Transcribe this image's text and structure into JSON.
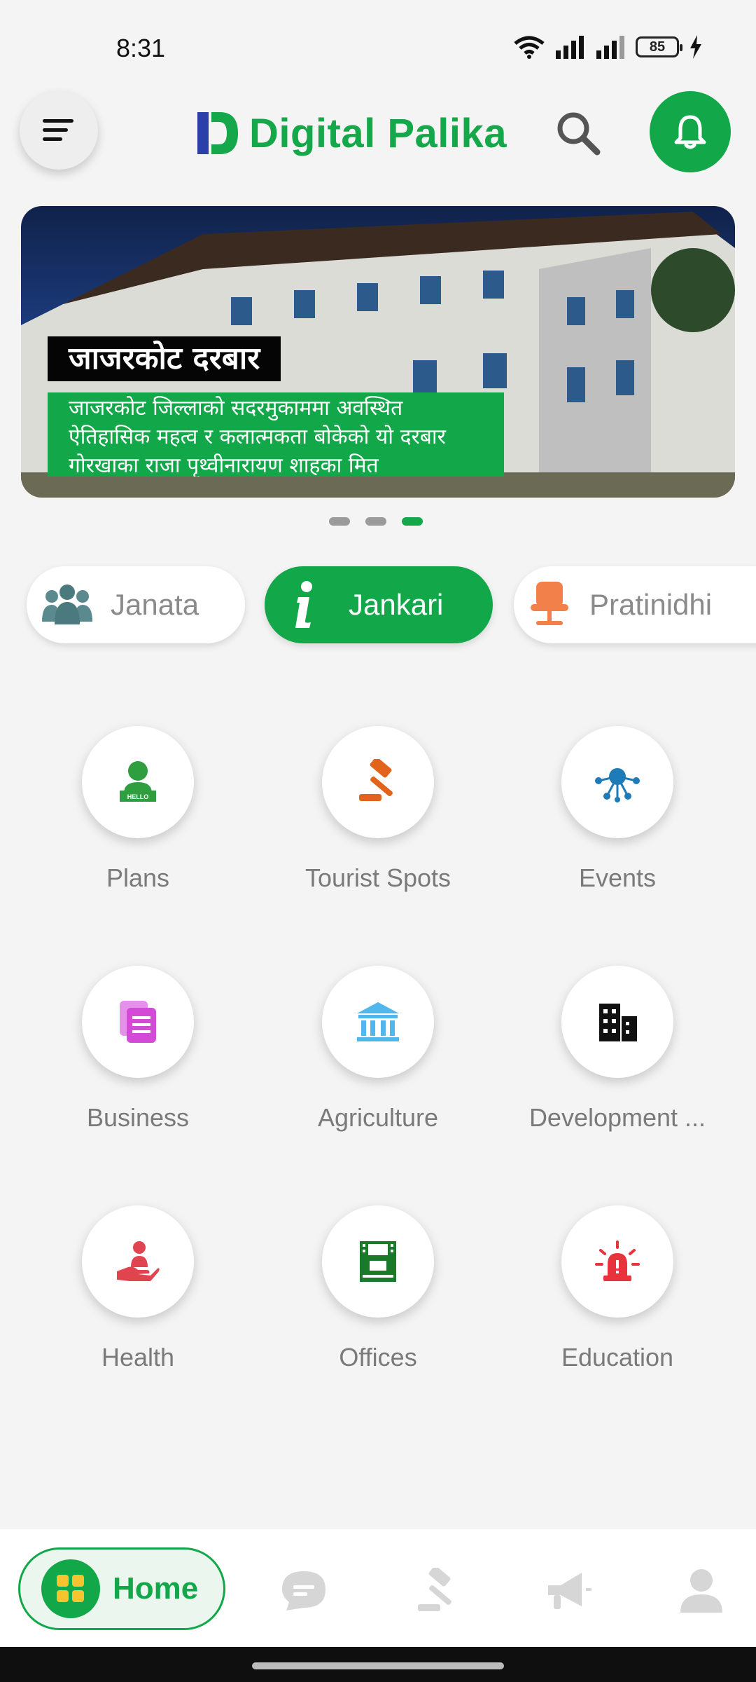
{
  "status_bar": {
    "time": "8:31",
    "battery": "85"
  },
  "header": {
    "app_name": "Digital Palika"
  },
  "banner": {
    "title": "जाजरकोट दरबार",
    "description": "जाजरकोट जिल्लाको सदरमुकाममा अवस्थित ऐतिहासिक महत्व र कलात्मकता बोकेको यो दरबार गोरखाका राजा पृथ्वीनारायण शाहका मित",
    "slides": 3,
    "active_slide": 3
  },
  "tabs": [
    {
      "label": "Janata",
      "icon": "people-group-icon",
      "selected": false
    },
    {
      "label": "Jankari",
      "icon": "info-icon",
      "selected": true
    },
    {
      "label": "Pratinidhi",
      "icon": "chair-icon",
      "selected": false
    }
  ],
  "grid": [
    {
      "label": "Plans",
      "icon": "hello-person-icon",
      "color": "#2e9e3e"
    },
    {
      "label": "Tourist Spots",
      "icon": "gavel-icon",
      "color": "#e2631c"
    },
    {
      "label": "Events",
      "icon": "network-icon",
      "color": "#1e7bb8"
    },
    {
      "label": "Business",
      "icon": "documents-icon",
      "color": "#d24ad6"
    },
    {
      "label": "Agriculture",
      "icon": "bank-icon",
      "color": "#4fb6ee"
    },
    {
      "label": "Development ...",
      "icon": "buildings-icon",
      "color": "#111111"
    },
    {
      "label": "Health",
      "icon": "hand-care-icon",
      "color": "#e0454f"
    },
    {
      "label": "Offices",
      "icon": "film-office-icon",
      "color": "#1a7a2a"
    },
    {
      "label": "Education",
      "icon": "alarm-light-icon",
      "color": "#e8323c"
    }
  ],
  "bottom_nav": {
    "home_label": "Home",
    "items": [
      "home-grid-icon",
      "chat-icon",
      "gavel-icon",
      "megaphone-icon",
      "profile-icon"
    ]
  },
  "colors": {
    "brand_green": "#12a84a",
    "logo_blue": "#2a3fa8"
  }
}
